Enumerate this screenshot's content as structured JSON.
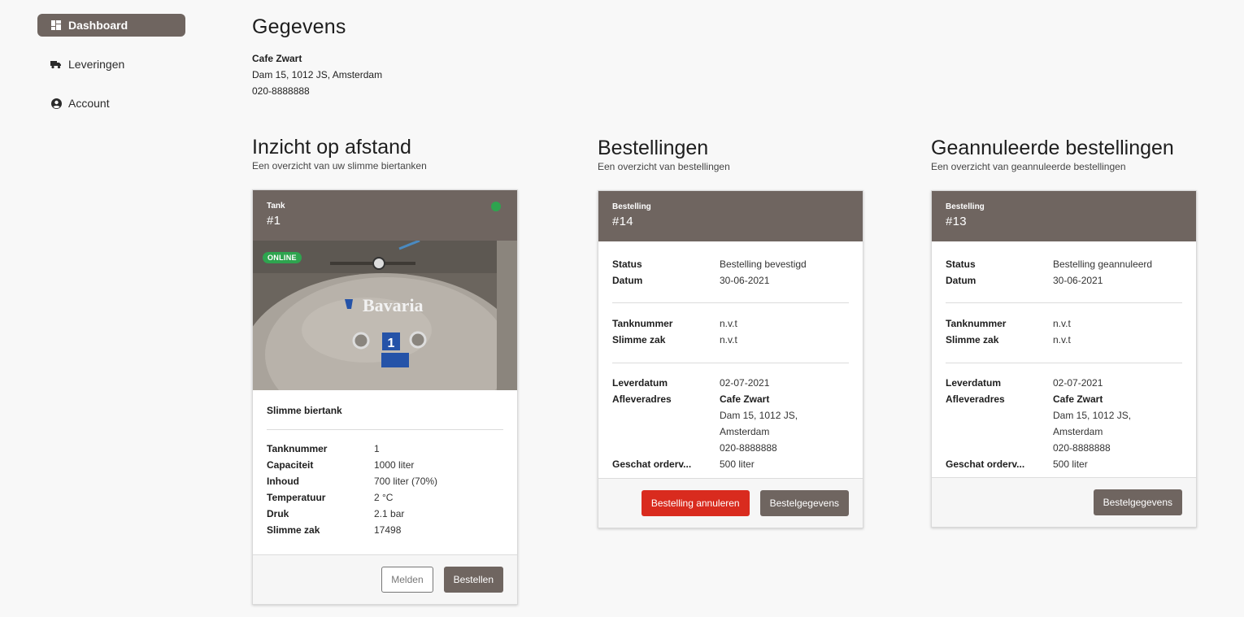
{
  "sidebar": {
    "items": [
      {
        "label": "Dashboard",
        "icon": "dashboard-icon",
        "active": true
      },
      {
        "label": "Leveringen",
        "icon": "truck-icon",
        "active": false
      },
      {
        "label": "Account",
        "icon": "user-circle-icon",
        "active": false
      }
    ]
  },
  "gegevens": {
    "title": "Gegevens",
    "name": "Cafe Zwart",
    "address": "Dam 15, 1012 JS, Amsterdam",
    "phone": "020-8888888"
  },
  "tank_section": {
    "title": "Inzicht op afstand",
    "subtitle": "Een overzicht van uw slimme biertanken",
    "card": {
      "kicker": "Tank",
      "number": "#1",
      "status_color": "#2ea44f",
      "badge": "ONLINE",
      "photo_text": "Bavaria",
      "photo_tank_number": "1",
      "name": "Slimme biertank",
      "rows": [
        {
          "key": "Tanknummer",
          "value": "1"
        },
        {
          "key": "Capaciteit",
          "value": "1000 liter"
        },
        {
          "key": "Inhoud",
          "value": "700 liter (70%)"
        },
        {
          "key": "Temperatuur",
          "value": "2 °C"
        },
        {
          "key": "Druk",
          "value": "2.1 bar"
        },
        {
          "key": "Slimme zak",
          "value": "17498"
        }
      ],
      "buttons": {
        "report": "Melden",
        "order": "Bestellen"
      }
    }
  },
  "orders_section": {
    "title": "Bestellingen",
    "subtitle": "Een overzicht van bestellingen",
    "card": {
      "kicker": "Bestelling",
      "number": "#14",
      "status_key": "Status",
      "status_value": "Bestelling bevestigd",
      "date_key": "Datum",
      "date_value": "30-06-2021",
      "tank_key": "Tanknummer",
      "tank_value": "n.v.t",
      "bag_key": "Slimme zak",
      "bag_value": "n.v.t",
      "delivery_key": "Leverdatum",
      "delivery_value": "02-07-2021",
      "address_key": "Afleveradres",
      "address_name": "Cafe Zwart",
      "address_line1": "Dam 15, 1012 JS,",
      "address_line2": "Amsterdam",
      "address_phone": "020-8888888",
      "size_key": "Geschat orderv...",
      "size_value": "500 liter",
      "buttons": {
        "cancel": "Bestelling annuleren",
        "details": "Bestelgegevens"
      }
    }
  },
  "cancelled_section": {
    "title": "Geannuleerde bestellingen",
    "subtitle": "Een overzicht van geannuleerde bestellingen",
    "card": {
      "kicker": "Bestelling",
      "number": "#13",
      "status_key": "Status",
      "status_value": "Bestelling geannuleerd",
      "date_key": "Datum",
      "date_value": "30-06-2021",
      "tank_key": "Tanknummer",
      "tank_value": "n.v.t",
      "bag_key": "Slimme zak",
      "bag_value": "n.v.t",
      "delivery_key": "Leverdatum",
      "delivery_value": "02-07-2021",
      "address_key": "Afleveradres",
      "address_name": "Cafe Zwart",
      "address_line1": "Dam 15, 1012 JS,",
      "address_line2": "Amsterdam",
      "address_phone": "020-8888888",
      "size_key": "Geschat orderv...",
      "size_value": "500 liter",
      "buttons": {
        "details": "Bestelgegevens"
      }
    }
  }
}
